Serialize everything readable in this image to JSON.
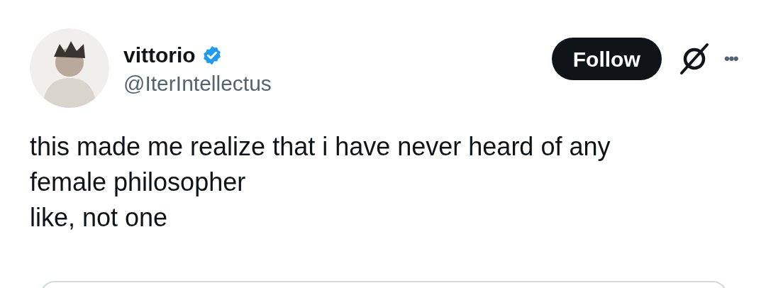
{
  "author": {
    "name": "vittorio",
    "verified": true,
    "handle": "@IterIntellectus"
  },
  "follow_button": {
    "label": "Follow"
  },
  "more_menu": {
    "label": "•••"
  },
  "post_text": "this made me realize that i have never heard of any\nfemale philosopher\nlike, not one",
  "quoted_post": {
    "kind": "card"
  }
}
